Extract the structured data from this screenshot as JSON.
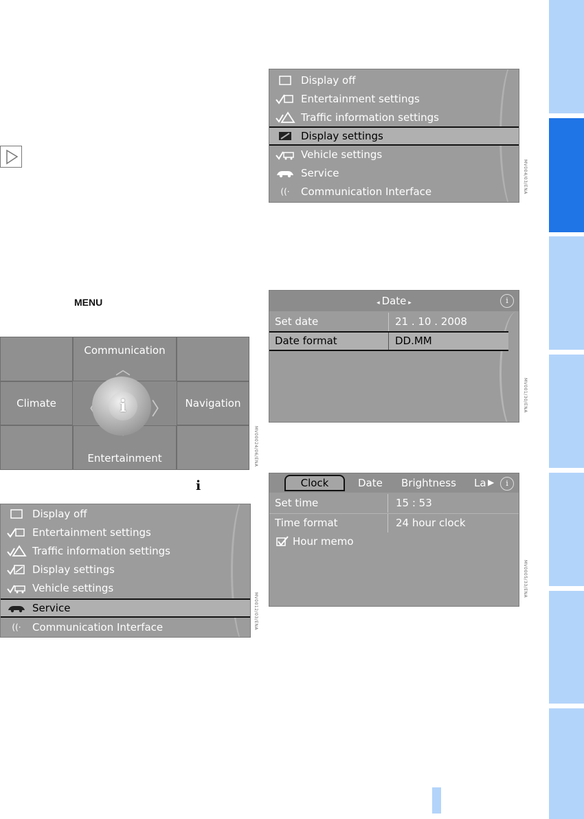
{
  "page": {
    "menu_label": "MENU",
    "info_symbol": "i"
  },
  "continue_marker": {
    "icon": "triangle-right-icon"
  },
  "screen_top": {
    "items": [
      {
        "label": "Display off",
        "icon": "square-icon"
      },
      {
        "label": "Entertainment settings",
        "icon": "entertainment-settings-icon"
      },
      {
        "label": "Traffic information settings",
        "icon": "traffic-warning-icon"
      },
      {
        "label": "Display settings",
        "icon": "display-settings-icon"
      },
      {
        "label": "Vehicle settings",
        "icon": "vehicle-settings-icon"
      },
      {
        "label": "Service",
        "icon": "car-icon"
      },
      {
        "label": "Communication Interface",
        "icon": "communication-icon"
      }
    ],
    "selected": "Display settings",
    "code": "MV004/03/ENA"
  },
  "controller": {
    "top": "Communication",
    "left": "Climate",
    "right": "Navigation",
    "bottom": "Entertainment",
    "center": "i",
    "code": "MV00024/06/ENA"
  },
  "screen_bottom": {
    "items": [
      {
        "label": "Display off",
        "icon": "square-icon"
      },
      {
        "label": "Entertainment settings",
        "icon": "entertainment-settings-icon"
      },
      {
        "label": "Traffic information settings",
        "icon": "traffic-warning-icon"
      },
      {
        "label": "Display settings",
        "icon": "display-settings-icon"
      },
      {
        "label": "Vehicle settings",
        "icon": "vehicle-settings-icon"
      },
      {
        "label": "Service",
        "icon": "car-icon"
      },
      {
        "label": "Communication Interface",
        "icon": "communication-icon"
      }
    ],
    "selected": "Service",
    "code": "MV0012/03/ENA"
  },
  "date_screen": {
    "title": "Date",
    "rows": [
      {
        "label": "Set date",
        "value": "21 . 10 . 2008"
      },
      {
        "label": "Date format",
        "value": "DD.MM"
      }
    ],
    "selected": "Date format",
    "code": "MV001/30/ENA"
  },
  "clock_screen": {
    "tabs": [
      "Clock",
      "Date",
      "Brightness",
      "La"
    ],
    "active_tab": "Clock",
    "rows": [
      {
        "label": "Set time",
        "value": "15 : 53"
      },
      {
        "label": "Time format",
        "value": "24 hour clock"
      }
    ],
    "checkbox": {
      "label": "Hour memo",
      "checked": true
    },
    "code": "MV0005/33/ENA"
  },
  "colors": {
    "accent": "#1f74e6",
    "tab_light": "#b3d4fa",
    "screen_bg": "#9c9c9c"
  }
}
